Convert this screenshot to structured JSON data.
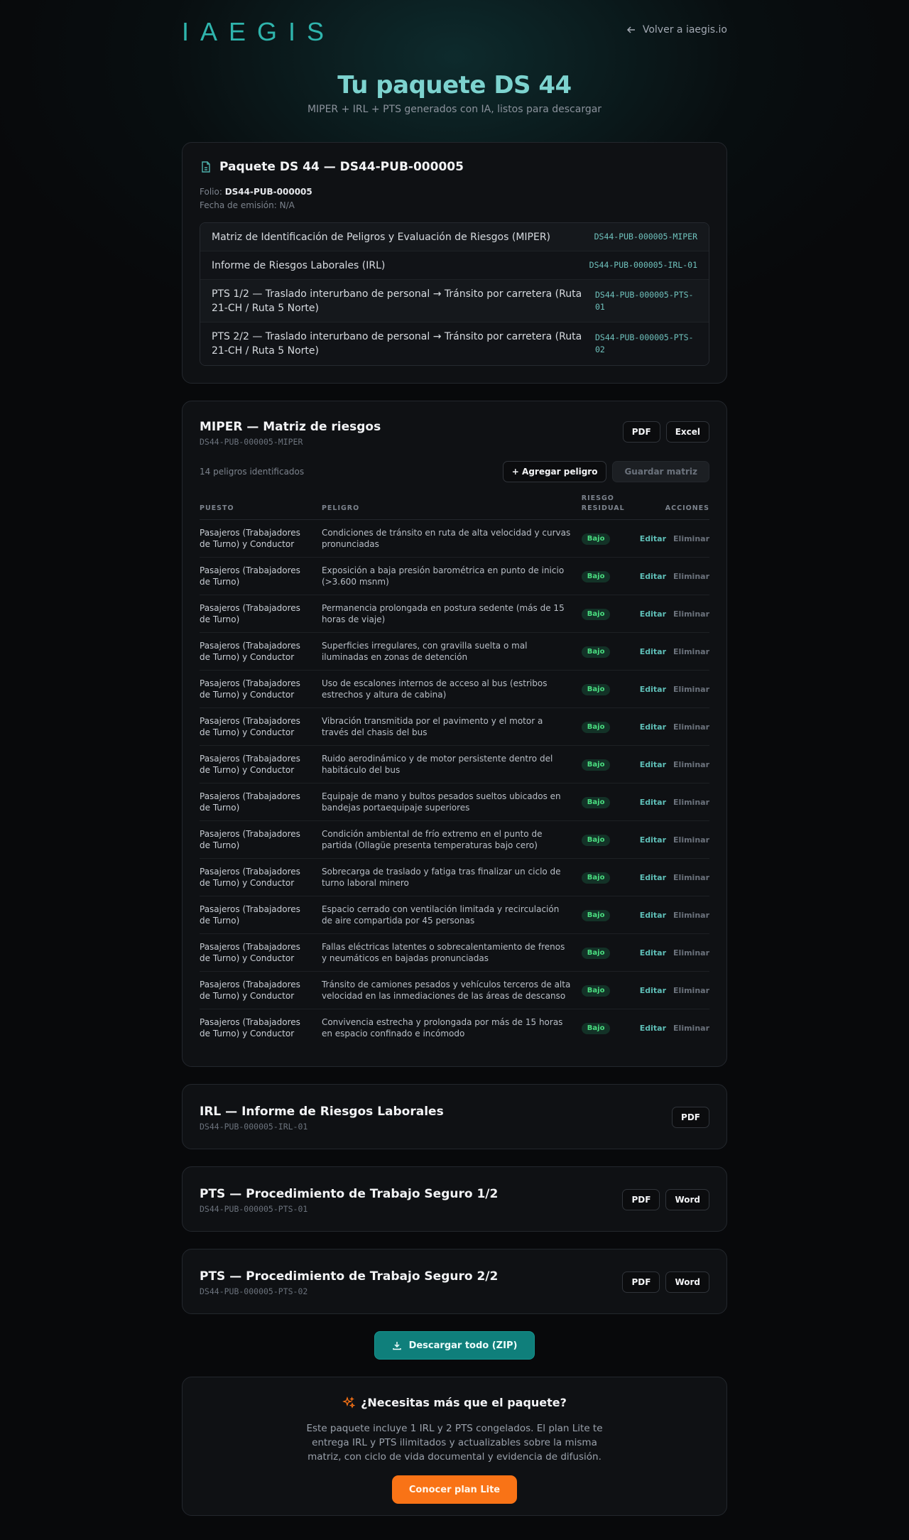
{
  "header": {
    "logo": "IAEGIS",
    "back_label": "Volver a iaegis.io"
  },
  "hero": {
    "title": "Tu paquete DS 44",
    "subtitle": "MIPER + IRL + PTS generados con IA, listos para descargar"
  },
  "package": {
    "title": "Paquete DS 44 — DS44-PUB-000005",
    "folio_label": "Folio:",
    "folio_value": "DS44-PUB-000005",
    "fecha": "Fecha de emisión: N/A",
    "docs": [
      {
        "name": "Matriz de Identificación de Peligros y Evaluación de Riesgos (MIPER)",
        "code": "DS44-PUB-000005-MIPER"
      },
      {
        "name": "Informe de Riesgos Laborales (IRL)",
        "code": "DS44-PUB-000005-IRL-01"
      },
      {
        "name": "PTS 1/2 — Traslado interurbano de personal → Tránsito por carretera (Ruta 21-CH / Ruta 5 Norte)",
        "code": "DS44-PUB-000005-PTS-01"
      },
      {
        "name": "PTS 2/2 — Traslado interurbano de personal → Tránsito por carretera (Ruta 21-CH / Ruta 5 Norte)",
        "code": "DS44-PUB-000005-PTS-02"
      }
    ]
  },
  "miper": {
    "title": "MIPER — Matriz de riesgos",
    "code": "DS44-PUB-000005-MIPER",
    "pdf_label": "PDF",
    "excel_label": "Excel",
    "count": "14 peligros identificados",
    "add_label": "+ Agregar peligro",
    "save_label": "Guardar matriz",
    "columns": {
      "puesto": "PUESTO",
      "peligro": "PELIGRO",
      "riesgo": "RIESGO RESIDUAL",
      "acciones": "ACCIONES"
    },
    "edit_label": "Editar",
    "delete_label": "Eliminar",
    "rows": [
      {
        "puesto": "Pasajeros (Trabajadores de Turno) y Conductor",
        "peligro": "Condiciones de tránsito en ruta de alta velocidad y curvas pronunciadas",
        "riesgo": "Bajo"
      },
      {
        "puesto": "Pasajeros (Trabajadores de Turno)",
        "peligro": "Exposición a baja presión barométrica en punto de inicio (>3.600 msnm)",
        "riesgo": "Bajo"
      },
      {
        "puesto": "Pasajeros (Trabajadores de Turno)",
        "peligro": "Permanencia prolongada en postura sedente (más de 15 horas de viaje)",
        "riesgo": "Bajo"
      },
      {
        "puesto": "Pasajeros (Trabajadores de Turno) y Conductor",
        "peligro": "Superficies irregulares, con gravilla suelta o mal iluminadas en zonas de detención",
        "riesgo": "Bajo"
      },
      {
        "puesto": "Pasajeros (Trabajadores de Turno) y Conductor",
        "peligro": "Uso de escalones internos de acceso al bus (estribos estrechos y altura de cabina)",
        "riesgo": "Bajo"
      },
      {
        "puesto": "Pasajeros (Trabajadores de Turno) y Conductor",
        "peligro": "Vibración transmitida por el pavimento y el motor a través del chasis del bus",
        "riesgo": "Bajo"
      },
      {
        "puesto": "Pasajeros (Trabajadores de Turno) y Conductor",
        "peligro": "Ruido aerodinámico y de motor persistente dentro del habitáculo del bus",
        "riesgo": "Bajo"
      },
      {
        "puesto": "Pasajeros (Trabajadores de Turno)",
        "peligro": "Equipaje de mano y bultos pesados sueltos ubicados en bandejas portaequipaje superiores",
        "riesgo": "Bajo"
      },
      {
        "puesto": "Pasajeros (Trabajadores de Turno)",
        "peligro": "Condición ambiental de frío extremo en el punto de partida (Ollagüe presenta temperaturas bajo cero)",
        "riesgo": "Bajo"
      },
      {
        "puesto": "Pasajeros (Trabajadores de Turno) y Conductor",
        "peligro": "Sobrecarga de traslado y fatiga tras finalizar un ciclo de turno laboral minero",
        "riesgo": "Bajo"
      },
      {
        "puesto": "Pasajeros (Trabajadores de Turno)",
        "peligro": "Espacio cerrado con ventilación limitada y recirculación de aire compartida por 45 personas",
        "riesgo": "Bajo"
      },
      {
        "puesto": "Pasajeros (Trabajadores de Turno) y Conductor",
        "peligro": "Fallas eléctricas latentes o sobrecalentamiento de frenos y neumáticos en bajadas pronunciadas",
        "riesgo": "Bajo"
      },
      {
        "puesto": "Pasajeros (Trabajadores de Turno) y Conductor",
        "peligro": "Tránsito de camiones pesados y vehículos terceros de alta velocidad en las inmediaciones de las áreas de descanso",
        "riesgo": "Bajo"
      },
      {
        "puesto": "Pasajeros (Trabajadores de Turno) y Conductor",
        "peligro": "Convivencia estrecha y prolongada por más de 15 horas en espacio confinado e incómodo",
        "riesgo": "Bajo"
      }
    ]
  },
  "irl": {
    "title": "IRL — Informe de Riesgos Laborales",
    "code": "DS44-PUB-000005-IRL-01",
    "pdf_label": "PDF"
  },
  "pts1": {
    "title": "PTS — Procedimiento de Trabajo Seguro 1/2",
    "code": "DS44-PUB-000005-PTS-01",
    "pdf_label": "PDF",
    "word_label": "Word"
  },
  "pts2": {
    "title": "PTS — Procedimiento de Trabajo Seguro 2/2",
    "code": "DS44-PUB-000005-PTS-02",
    "pdf_label": "PDF",
    "word_label": "Word"
  },
  "zip": {
    "label": "Descargar todo (ZIP)"
  },
  "lite": {
    "title": "¿Necesitas más que el paquete?",
    "body": "Este paquete incluye 1 IRL y 2 PTS congelados. El plan Lite te entrega IRL y PTS ilimitados y actualizables sobre la misma matriz, con ciclo de vida documental y evidencia de difusión.",
    "cta": "Conocer plan Lite"
  },
  "icons": {
    "back": "arrow-left-icon",
    "file": "file-icon",
    "download": "download-icon",
    "sparkles": "sparkles-icon"
  },
  "colors": {
    "accent": "#2fb5ad",
    "badge_low": "#4ade80",
    "cta_orange": "#f97316",
    "zip_teal": "#0f7f7b"
  }
}
